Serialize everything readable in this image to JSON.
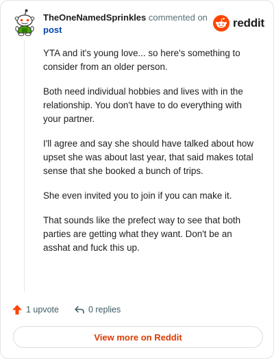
{
  "comment": {
    "author": "TheOneNamedSprinkles",
    "action_text": "commented on",
    "post_link": "post",
    "paragraphs": [
      "YTA and it's young love... so here's something to consider from an older person.",
      "Both need individual hobbies and lives with in the relationship. You don't have to do everything with your partner.",
      "I'll agree and say she should have talked about how upset she was about last year, that said makes total sense that she booked a bunch of trips.",
      "She even invited you to join if you can make it.",
      "That sounds like the prefect way to see that both parties are getting what they want. Don't be an asshat and fuck this up."
    ]
  },
  "brand": {
    "name": "reddit",
    "icon": "reddit-alien-icon",
    "color": "#ff4500"
  },
  "actions": {
    "upvote_label": "1 upvote",
    "upvote_icon": "upvote-arrow-icon",
    "upvote_color": "#ff4500",
    "replies_label": "0 replies",
    "replies_icon": "reply-arrow-icon"
  },
  "footer": {
    "view_more_label": "View more on Reddit",
    "view_more_color": "#d93a00"
  }
}
